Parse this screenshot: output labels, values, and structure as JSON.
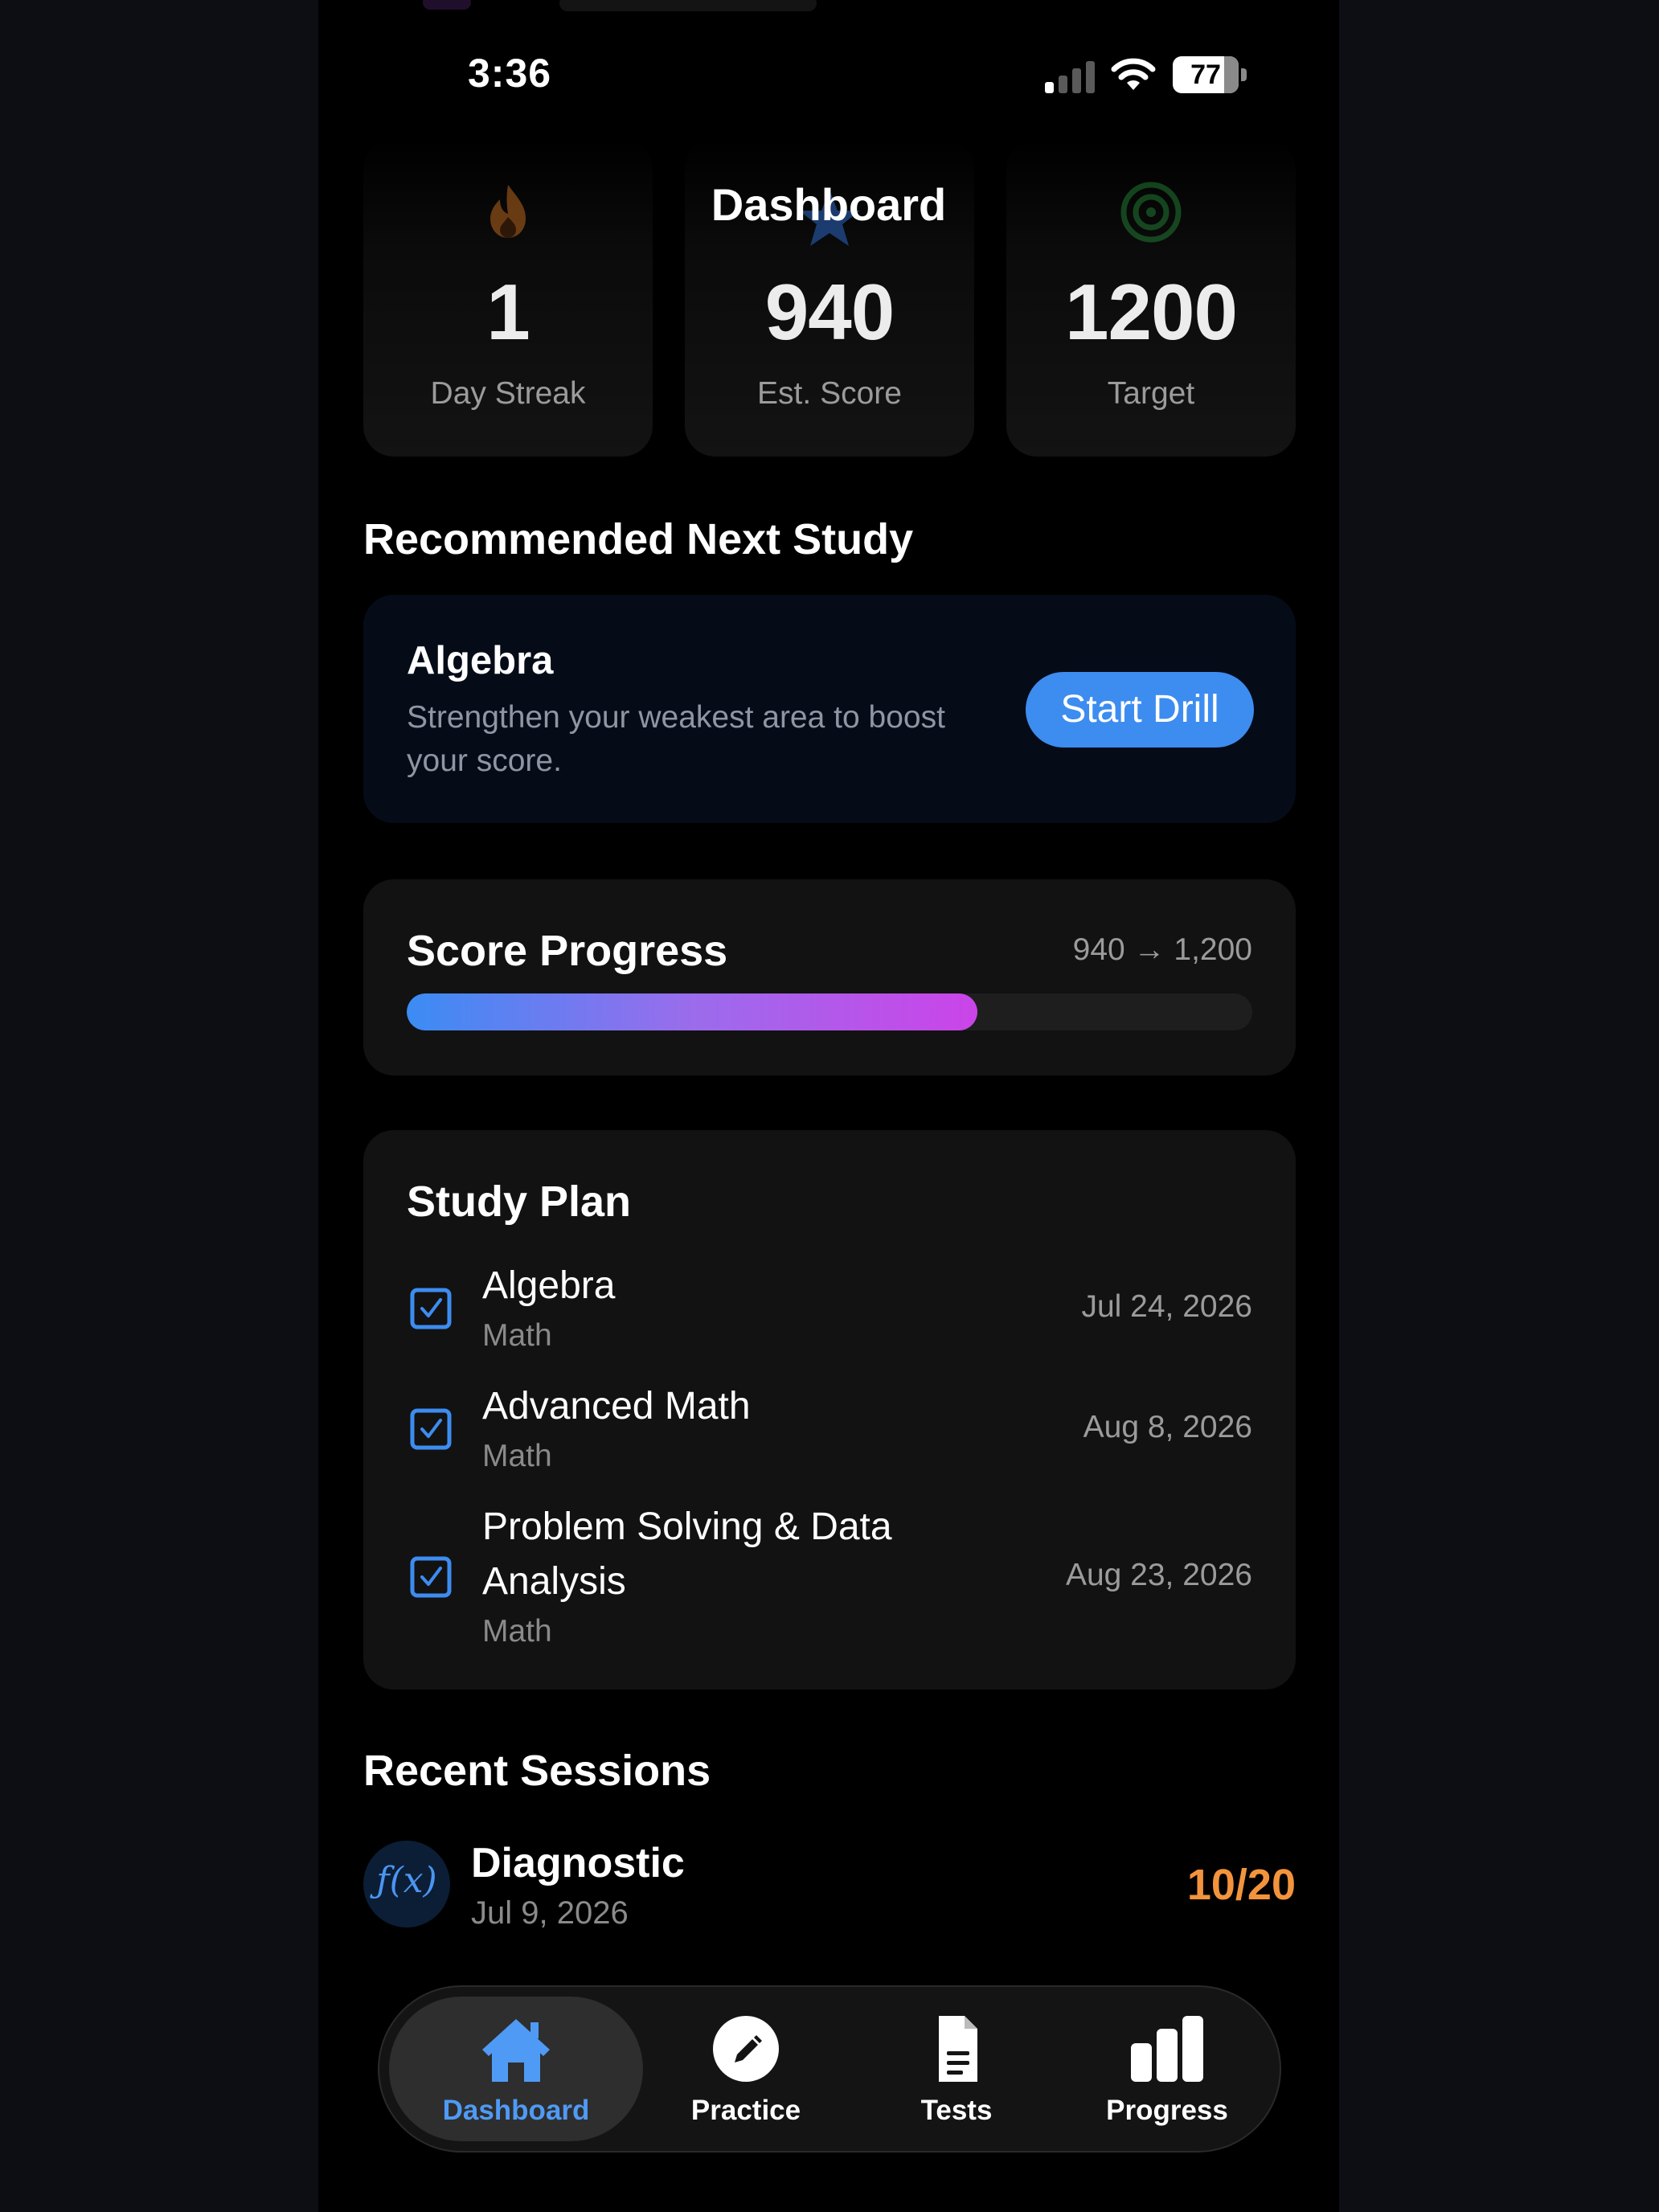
{
  "status_bar": {
    "time": "3:36",
    "battery": "77"
  },
  "header": {
    "title": "Dashboard"
  },
  "stats": [
    {
      "value": "1",
      "label": "Day Streak",
      "icon": "flame-icon"
    },
    {
      "value": "940",
      "label": "Est. Score",
      "icon": "star-icon"
    },
    {
      "value": "1200",
      "label": "Target",
      "icon": "target-icon"
    }
  ],
  "recommended": {
    "section_title": "Recommended Next Study",
    "subject": "Algebra",
    "description": "Strengthen your weakest area to boost your score.",
    "button_label": "Start Drill"
  },
  "score_progress": {
    "title": "Score Progress",
    "range_text": "940 → 1,200",
    "progress_fraction": 0.675,
    "gradient": [
      "#3b8cf4",
      "#cb44e8"
    ]
  },
  "study_plan": {
    "title": "Study Plan",
    "items": [
      {
        "name": "Algebra",
        "category": "Math",
        "date": "Jul 24, 2026",
        "checked": true
      },
      {
        "name": "Advanced Math",
        "category": "Math",
        "date": "Aug 8, 2026",
        "checked": true
      },
      {
        "name": "Problem Solving & Data Analysis",
        "category": "Math",
        "date": "Aug 23, 2026",
        "checked": true
      }
    ]
  },
  "recent_sessions": {
    "section_title": "Recent Sessions",
    "items": [
      {
        "icon_text": "ƒ(x)",
        "name": "Diagnostic",
        "date": "Jul 9, 2026",
        "score": "10/20"
      }
    ]
  },
  "tabs": [
    {
      "label": "Dashboard",
      "icon": "house-icon",
      "active": true
    },
    {
      "label": "Practice",
      "icon": "pencil-icon",
      "active": false
    },
    {
      "label": "Tests",
      "icon": "document-icon",
      "active": false
    },
    {
      "label": "Progress",
      "icon": "bar-chart-icon",
      "active": false
    }
  ],
  "colors": {
    "accent": "#3d8cf0",
    "score_orange": "#f2943d",
    "tab_active": "#4f9af5"
  }
}
